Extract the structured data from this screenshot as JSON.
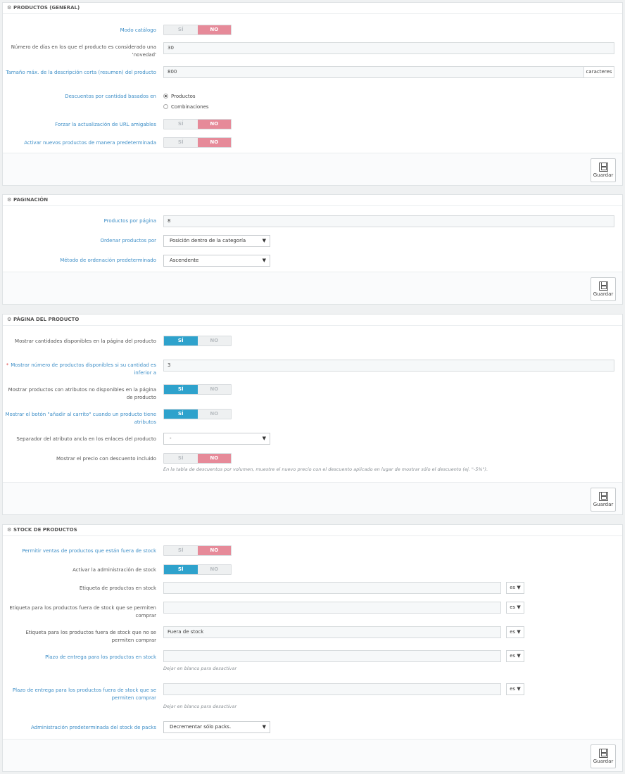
{
  "panels": {
    "general": {
      "title": "PRODUCTOS (GENERAL)",
      "catalog_mode_label": "Modo catálogo",
      "days_new_label": "Número de días en los que el producto es considerado una 'novedad'",
      "days_new_value": "30",
      "short_desc_label": "Tamaño máx. de la descripción corta (resumen) del producto",
      "short_desc_value": "800",
      "short_desc_unit": "caracteres",
      "qty_discount_label": "Descuentos por cantidad basados en",
      "qty_discount_options": [
        "Productos",
        "Combinaciones"
      ],
      "force_url_label": "Forzar la actualización de URL amigables",
      "activate_new_label": "Activar nuevos productos de manera predeterminada",
      "save_label": "Guardar"
    },
    "pagination": {
      "title": "PAGINACIÓN",
      "per_page_label": "Productos por página",
      "per_page_value": "8",
      "order_by_label": "Ordenar productos por",
      "order_by_value": "Posición dentro de la categoría",
      "order_method_label": "Método de ordenación predeterminado",
      "order_method_value": "Ascendente",
      "save_label": "Guardar"
    },
    "product_page": {
      "title": "PÁGINA DEL PRODUCTO",
      "show_qty_label": "Mostrar cantidades disponibles en la página del producto",
      "low_stock_label": "Mostrar número de productos disponibles si su cantidad es inferior a",
      "low_stock_required": "*",
      "low_stock_value": "3",
      "unavailable_attr_label": "Mostrar productos con atributos no disponibles en la página de producto",
      "add_to_cart_label": "Mostrar el botón \"añadir al carrito\" cuando un producto tiene atributos",
      "anchor_sep_label": "Separador del atributo ancla en los enlaces del producto",
      "anchor_sep_value": "-",
      "discount_price_label": "Mostrar el precio con descuento incluido",
      "discount_price_help": "En la tabla de descuentos por volumen, muestre el nuevo precio con el descuento aplicado en lugar de mostrar sólo el descuento (ej. \"-5%\").",
      "save_label": "Guardar"
    },
    "stock": {
      "title": "STOCK DE PRODUCTOS",
      "allow_oos_label": "Permitir ventas de productos que están fuera de stock",
      "manage_stock_label": "Activar la administración de stock",
      "in_stock_label": "Etiqueta de productos en stock",
      "in_stock_value": "",
      "oos_allowed_label": "Etiqueta para los productos fuera de stock que se permiten comprar",
      "oos_allowed_value": "",
      "oos_denied_label": "Etiqueta para los productos fuera de stock que no se permiten comprar",
      "oos_denied_value": "Fuera de stock",
      "delivery_in_label": "Plazo de entrega para los productos en stock",
      "delivery_in_value": "",
      "delivery_help": "Dejar en blanco para desactivar",
      "delivery_oos_label": "Plazo de entrega para los productos fuera de stock que se permiten comprar",
      "delivery_oos_value": "",
      "pack_stock_label": "Administración predeterminada del stock de packs",
      "pack_stock_value": "Decrementar sólo packs.",
      "save_label": "Guardar"
    }
  },
  "common": {
    "yes": "SÍ",
    "no": "NO",
    "lang": "es",
    "gear_icon": "⚙",
    "caret": "▼"
  },
  "colors": {
    "no_active": "#e68a99",
    "yes_active": "#2ea2cc",
    "link_label": "#3d8ec7"
  }
}
